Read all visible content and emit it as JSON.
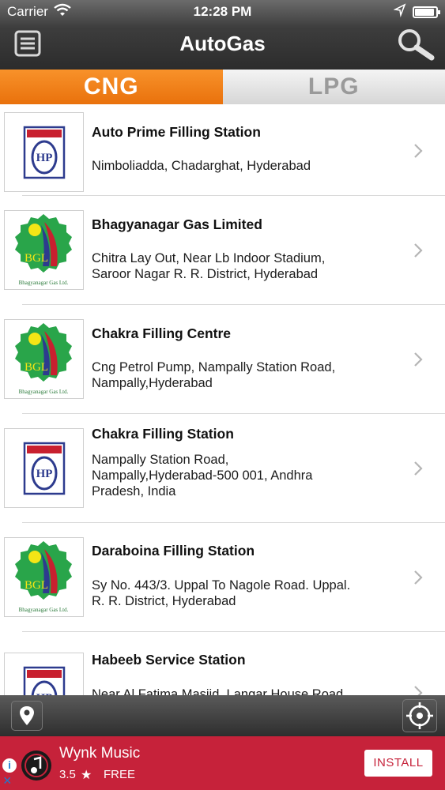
{
  "status": {
    "carrier": "Carrier",
    "time": "12:28 PM"
  },
  "header": {
    "title": "AutoGas"
  },
  "tabs": [
    {
      "label": "CNG",
      "selected": true
    },
    {
      "label": "LPG",
      "selected": false
    }
  ],
  "stations": [
    {
      "name": "Auto Prime Filling Station",
      "address": [
        "Nimboliadda, Chadarghat, Hyderabad"
      ],
      "logo": "hp-logo"
    },
    {
      "name": "Bhagyanagar Gas Limited",
      "address": [
        "Chitra Lay Out, Near Lb Indoor Stadium,",
        "Saroor Nagar R. R. District, Hyderabad"
      ],
      "logo": "bgl-logo"
    },
    {
      "name": "Chakra Filling Centre",
      "address": [
        "Cng Petrol Pump, Nampally Station Road,",
        "Nampally,Hyderabad"
      ],
      "logo": "bgl-logo"
    },
    {
      "name": "Chakra Filling Station",
      "address": [
        "Nampally Station Road,",
        "Nampally,Hyderabad-500 001, Andhra",
        "Pradesh, India"
      ],
      "logo": "hp-logo"
    },
    {
      "name": "Daraboina Filling Station",
      "address": [
        "Sy No. 443/3. Uppal To Nagole Road. Uppal.",
        "R. R. District, Hyderabad"
      ],
      "logo": "bgl-logo"
    },
    {
      "name": "Habeeb Service Station",
      "address": [
        "Near Al Fatima Masjid, Langar House Road"
      ],
      "logo": "hp-logo"
    }
  ],
  "logos": {
    "bgl_text": "BGL",
    "bgl_caption": "Bhagyanagar Gas Ltd.",
    "hp_text": "HP"
  },
  "ad": {
    "info_icon": "i",
    "close_icon": "×",
    "app_name": "Wynk Music",
    "rating": "3.5",
    "star": "★",
    "price": "FREE",
    "install_label": "INSTALL"
  },
  "colors": {
    "cng_tab": "#f08a1c",
    "ad_bg": "#c6223a",
    "bar_dark": "#2c2c2c"
  }
}
